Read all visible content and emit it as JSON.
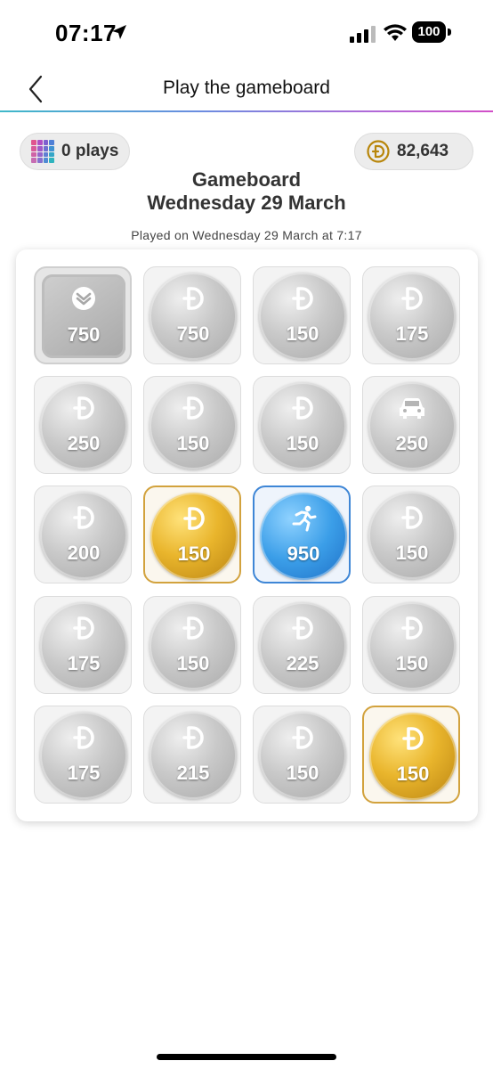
{
  "status_bar": {
    "time": "07:17",
    "battery": "100"
  },
  "nav": {
    "title": "Play the gameboard"
  },
  "plays_chip": {
    "label": "0 plays"
  },
  "points_chip": {
    "label": "82,643"
  },
  "board": {
    "title_line1": "Gameboard",
    "title_line2": "Wednesday 29 March",
    "played_on": "Played on Wednesday 29 March at 7:17",
    "tiles": [
      {
        "value": "750",
        "style": "square",
        "icon": "brand-chevron-icon"
      },
      {
        "value": "750",
        "style": "silver",
        "icon": "dollar-d-icon"
      },
      {
        "value": "150",
        "style": "silver",
        "icon": "dollar-d-icon"
      },
      {
        "value": "175",
        "style": "silver",
        "icon": "dollar-d-icon"
      },
      {
        "value": "250",
        "style": "silver",
        "icon": "dollar-d-icon"
      },
      {
        "value": "150",
        "style": "silver",
        "icon": "dollar-d-icon"
      },
      {
        "value": "150",
        "style": "silver",
        "icon": "dollar-d-icon"
      },
      {
        "value": "250",
        "style": "silver",
        "icon": "car-icon"
      },
      {
        "value": "200",
        "style": "silver",
        "icon": "dollar-d-icon"
      },
      {
        "value": "150",
        "style": "gold",
        "icon": "dollar-d-icon"
      },
      {
        "value": "950",
        "style": "blue",
        "icon": "runner-icon"
      },
      {
        "value": "150",
        "style": "silver",
        "icon": "dollar-d-icon"
      },
      {
        "value": "175",
        "style": "silver",
        "icon": "dollar-d-icon"
      },
      {
        "value": "150",
        "style": "silver",
        "icon": "dollar-d-icon"
      },
      {
        "value": "225",
        "style": "silver",
        "icon": "dollar-d-icon"
      },
      {
        "value": "150",
        "style": "silver",
        "icon": "dollar-d-icon"
      },
      {
        "value": "175",
        "style": "silver",
        "icon": "dollar-d-icon"
      },
      {
        "value": "215",
        "style": "silver",
        "icon": "dollar-d-icon"
      },
      {
        "value": "150",
        "style": "silver",
        "icon": "dollar-d-icon"
      },
      {
        "value": "150",
        "style": "gold",
        "icon": "dollar-d-icon"
      }
    ]
  },
  "colors": {
    "accent_gold": "#d2a23d",
    "accent_blue": "#3e86d6",
    "divider_start": "#3fb8c9",
    "divider_end": "#d24fc8"
  }
}
